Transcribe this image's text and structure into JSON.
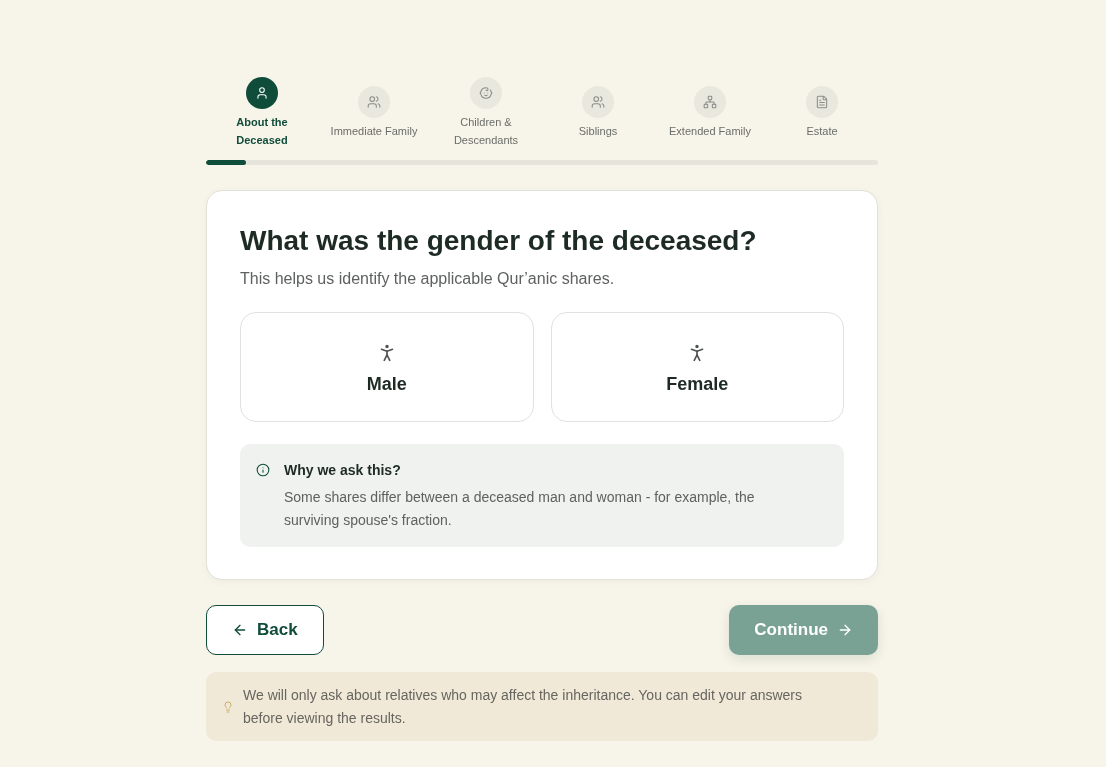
{
  "stepper": {
    "steps": [
      {
        "label": "About the Deceased",
        "selected": true
      },
      {
        "label": "Immediate Family",
        "selected": false
      },
      {
        "label": "Children & Descendants",
        "selected": false
      },
      {
        "label": "Siblings",
        "selected": false
      },
      {
        "label": "Extended Family",
        "selected": false
      },
      {
        "label": "Estate",
        "selected": false
      }
    ],
    "progress": {
      "level": 0.06
    }
  },
  "question": {
    "title": "What was the gender of the deceased?",
    "subtitle": "This helps us identify the applicable Qur’anic shares.",
    "options": [
      {
        "label": "Male",
        "selected": false
      },
      {
        "label": "Female",
        "selected": false
      }
    ],
    "info": {
      "title": "Why we ask this?",
      "body": "Some shares differ between a deceased man and woman - for example, the surviving spouse's fraction."
    }
  },
  "navigation": {
    "back": {
      "label": "Back"
    },
    "continue": {
      "label": "Continue",
      "disabled": true
    }
  },
  "tip": {
    "text": "We will only ask about relatives who may affect the inheritance. You can edit your answers before viewing the results."
  }
}
